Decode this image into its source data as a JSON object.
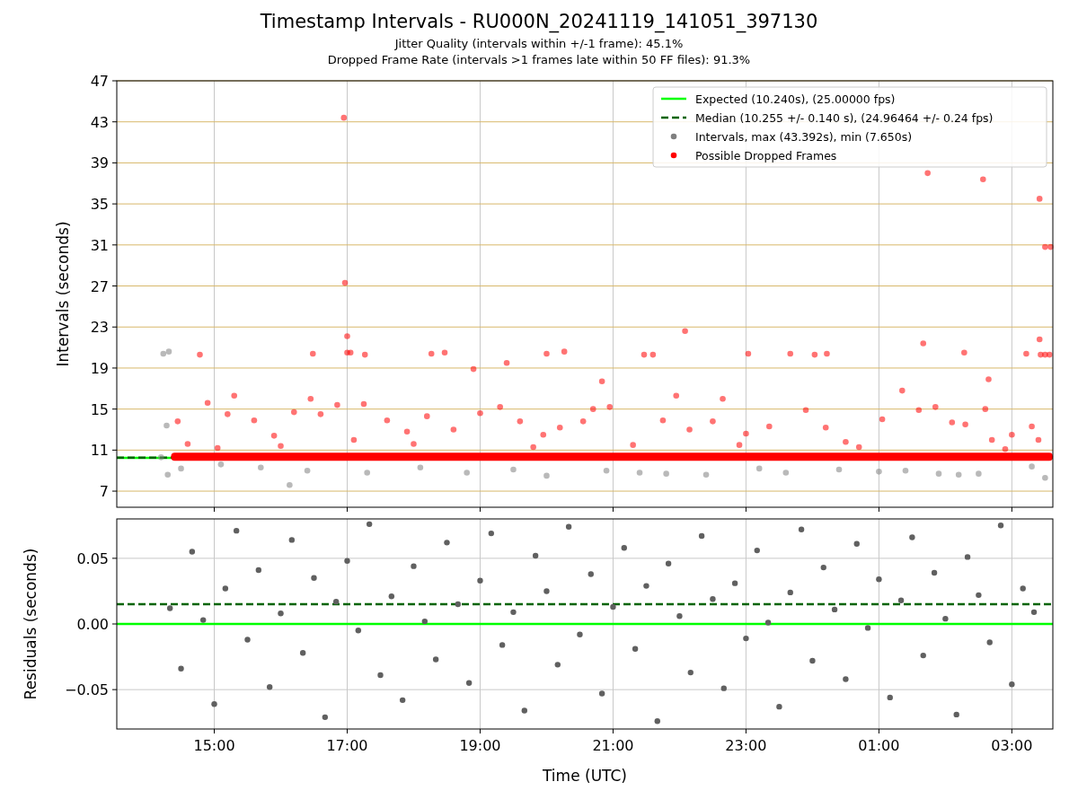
{
  "title": "Timestamp Intervals - RU000N_20241119_141051_397130",
  "subtitles": [
    "Jitter Quality (intervals within +/-1 frame): 45.1%",
    "Dropped Frame Rate (intervals >1 frames late within 50 FF files): 91.3%"
  ],
  "charts": [
    {
      "chart_data": {
        "type": "scatter",
        "ylabel": "Intervals (seconds)",
        "grid": true,
        "xlim": [
          "2024-11-19T13:32",
          "2024-11-20T03:37"
        ],
        "ylim": [
          5.43,
          47
        ],
        "yticks": [
          {
            "value": 7,
            "label": "7"
          },
          {
            "value": 11,
            "label": "11"
          },
          {
            "value": 15,
            "label": "15"
          },
          {
            "value": 19,
            "label": "19"
          },
          {
            "value": 23,
            "label": "23"
          },
          {
            "value": 27,
            "label": "27"
          },
          {
            "value": 31,
            "label": "31"
          },
          {
            "value": 35,
            "label": "35"
          },
          {
            "value": 39,
            "label": "39"
          },
          {
            "value": 43,
            "label": "43"
          },
          {
            "value": 47,
            "label": "47"
          }
        ],
        "legend": true,
        "ref_lines": [
          {
            "axis": "y",
            "value": 10.24,
            "label": "Expected (10.240s), (25.00000 fps)",
            "color": "#00ff00"
          },
          {
            "axis": "y",
            "value": 10.255,
            "label": "Median (10.255 +/- 0.140 s), (24.96464 +/- 0.24 fps)",
            "color": "#006400"
          }
        ],
        "bands": [
          {
            "axis": "y",
            "from": 9.95,
            "to": 10.75,
            "color": "#ff0000"
          }
        ],
        "series": [
          {
            "name": "Intervals, max (43.392s), min (7.650s)",
            "color": "#808080",
            "x": [
              "2024-11-19T14:14",
              "2024-11-19T14:19",
              "2024-11-19T14:17",
              "2024-11-19T14:18",
              "2024-11-19T16:08",
              "2024-11-19T14:30",
              "2024-11-19T15:06",
              "2024-11-19T15:42",
              "2024-11-19T16:24",
              "2024-11-19T17:18",
              "2024-11-19T18:06",
              "2024-11-19T18:48",
              "2024-11-19T19:30",
              "2024-11-19T20:00",
              "2024-11-19T20:54",
              "2024-11-19T21:24",
              "2024-11-19T21:48",
              "2024-11-19T22:24",
              "2024-11-19T23:12",
              "2024-11-19T23:36",
              "2024-11-20T00:24",
              "2024-11-20T01:00",
              "2024-11-20T01:24",
              "2024-11-20T01:54",
              "2024-11-20T02:12",
              "2024-11-20T02:30",
              "2024-11-20T03:30",
              "2024-11-20T03:18",
              "2024-11-19T14:12"
            ],
            "values": [
              20.4,
              20.6,
              13.4,
              8.6,
              7.6,
              9.2,
              9.6,
              9.3,
              9.0,
              8.8,
              9.3,
              8.8,
              9.1,
              8.5,
              9.0,
              8.8,
              8.7,
              8.6,
              9.2,
              8.8,
              9.1,
              8.9,
              9.0,
              8.7,
              8.6,
              8.7,
              8.3,
              9.4,
              10.3
            ]
          },
          {
            "name": "Possible Dropped Frames",
            "color": "#ff0000",
            "x": [
              "2024-11-19T16:57",
              "2024-11-19T16:58",
              "2024-11-19T17:00",
              "2024-11-19T17:00",
              "2024-11-19T17:03",
              "2024-11-19T14:47",
              "2024-11-19T16:29",
              "2024-11-19T17:16",
              "2024-11-19T18:16",
              "2024-11-19T18:28",
              "2024-11-19T18:54",
              "2024-11-19T19:24",
              "2024-11-19T20:00",
              "2024-11-19T20:16",
              "2024-11-19T20:50",
              "2024-11-19T21:28",
              "2024-11-19T21:36",
              "2024-11-19T22:05",
              "2024-11-19T23:02",
              "2024-11-19T23:40",
              "2024-11-20T00:02",
              "2024-11-20T00:13",
              "2024-11-20T01:44",
              "2024-11-20T01:40",
              "2024-11-20T02:34",
              "2024-11-20T02:17",
              "2024-11-20T02:39",
              "2024-11-20T03:25",
              "2024-11-20T03:30",
              "2024-11-20T03:35",
              "2024-11-20T03:13",
              "2024-11-20T03:25",
              "2024-11-20T03:26",
              "2024-11-20T03:30",
              "2024-11-20T03:34",
              "2024-11-19T14:27",
              "2024-11-19T14:54",
              "2024-11-19T15:12",
              "2024-11-19T15:18",
              "2024-11-19T15:36",
              "2024-11-19T15:54",
              "2024-11-19T16:12",
              "2024-11-19T16:27",
              "2024-11-19T16:36",
              "2024-11-19T16:51",
              "2024-11-19T17:06",
              "2024-11-19T17:15",
              "2024-11-19T17:36",
              "2024-11-19T17:54",
              "2024-11-19T18:12",
              "2024-11-19T18:36",
              "2024-11-19T19:00",
              "2024-11-19T19:18",
              "2024-11-19T19:36",
              "2024-11-19T19:57",
              "2024-11-19T20:12",
              "2024-11-19T20:33",
              "2024-11-19T20:42",
              "2024-11-19T20:57",
              "2024-11-19T21:18",
              "2024-11-19T21:45",
              "2024-11-19T21:57",
              "2024-11-19T22:09",
              "2024-11-19T22:30",
              "2024-11-19T22:39",
              "2024-11-19T23:00",
              "2024-11-19T23:21",
              "2024-11-19T23:54",
              "2024-11-20T00:12",
              "2024-11-20T00:30",
              "2024-11-20T01:03",
              "2024-11-20T01:21",
              "2024-11-20T01:36",
              "2024-11-20T01:51",
              "2024-11-20T02:06",
              "2024-11-20T02:18",
              "2024-11-20T02:36",
              "2024-11-20T02:42",
              "2024-11-20T03:00",
              "2024-11-20T03:18",
              "2024-11-20T03:24",
              "2024-11-19T14:36",
              "2024-11-19T15:03",
              "2024-11-19T16:00",
              "2024-11-19T18:00",
              "2024-11-19T19:48",
              "2024-11-19T22:54",
              "2024-11-20T00:42",
              "2024-11-20T02:54"
            ],
            "values": [
              43.4,
              27.3,
              22.1,
              20.5,
              20.5,
              20.3,
              20.4,
              20.3,
              20.4,
              20.5,
              18.9,
              19.5,
              20.4,
              20.6,
              17.7,
              20.3,
              20.3,
              22.6,
              20.4,
              20.4,
              20.3,
              20.4,
              38.0,
              21.4,
              37.4,
              20.5,
              17.9,
              35.5,
              30.8,
              30.8,
              20.4,
              21.8,
              20.3,
              20.3,
              20.3,
              13.8,
              15.6,
              14.5,
              16.3,
              13.9,
              12.4,
              14.7,
              16.0,
              14.5,
              15.4,
              12.0,
              15.5,
              13.9,
              12.8,
              14.3,
              13.0,
              14.6,
              15.2,
              13.8,
              12.5,
              13.2,
              13.8,
              15.0,
              15.2,
              11.5,
              13.9,
              16.3,
              13.0,
              13.8,
              16.0,
              12.6,
              13.3,
              14.9,
              13.2,
              11.8,
              14.0,
              16.8,
              14.9,
              15.2,
              13.7,
              13.5,
              15.0,
              12.0,
              12.5,
              13.3,
              12.0,
              11.6,
              11.2,
              11.4,
              11.6,
              11.3,
              11.5,
              11.3,
              11.1
            ]
          }
        ]
      }
    },
    {
      "chart_data": {
        "type": "scatter",
        "xlabel": "Time (UTC)",
        "ylabel": "Residuals (seconds)",
        "grid": true,
        "xlim": [
          "2024-11-19T13:32",
          "2024-11-20T03:37"
        ],
        "ylim": [
          -0.08,
          0.08
        ],
        "xticks": [
          {
            "value": "2024-11-19T15:00",
            "label": "15:00"
          },
          {
            "value": "2024-11-19T17:00",
            "label": "17:00"
          },
          {
            "value": "2024-11-19T19:00",
            "label": "19:00"
          },
          {
            "value": "2024-11-19T21:00",
            "label": "21:00"
          },
          {
            "value": "2024-11-19T23:00",
            "label": "23:00"
          },
          {
            "value": "2024-11-20T01:00",
            "label": "01:00"
          },
          {
            "value": "2024-11-20T03:00",
            "label": "03:00"
          }
        ],
        "yticks": [
          {
            "value": -0.05,
            "label": "−0.05"
          },
          {
            "value": 0,
            "label": "0.00"
          },
          {
            "value": 0.05,
            "label": "0.05"
          }
        ],
        "ref_lines": [
          {
            "axis": "y",
            "value": 0,
            "color": "#00ff00"
          },
          {
            "axis": "y",
            "value": 0.015,
            "color": "#006400"
          }
        ],
        "series": [
          {
            "color": "#606060",
            "x": [
              "2024-11-19T14:20",
              "2024-11-19T14:30",
              "2024-11-19T14:40",
              "2024-11-19T14:50",
              "2024-11-19T15:00",
              "2024-11-19T15:10",
              "2024-11-19T15:20",
              "2024-11-19T15:30",
              "2024-11-19T15:40",
              "2024-11-19T15:50",
              "2024-11-19T16:00",
              "2024-11-19T16:10",
              "2024-11-19T16:20",
              "2024-11-19T16:30",
              "2024-11-19T16:40",
              "2024-11-19T16:50",
              "2024-11-19T17:00",
              "2024-11-19T17:10",
              "2024-11-19T17:20",
              "2024-11-19T17:30",
              "2024-11-19T17:40",
              "2024-11-19T17:50",
              "2024-11-19T18:00",
              "2024-11-19T18:10",
              "2024-11-19T18:20",
              "2024-11-19T18:30",
              "2024-11-19T18:40",
              "2024-11-19T18:50",
              "2024-11-19T19:00",
              "2024-11-19T19:10",
              "2024-11-19T19:20",
              "2024-11-19T19:30",
              "2024-11-19T19:40",
              "2024-11-19T19:50",
              "2024-11-19T20:00",
              "2024-11-19T20:10",
              "2024-11-19T20:20",
              "2024-11-19T20:30",
              "2024-11-19T20:40",
              "2024-11-19T20:50",
              "2024-11-19T21:00",
              "2024-11-19T21:10",
              "2024-11-19T21:20",
              "2024-11-19T21:30",
              "2024-11-19T21:40",
              "2024-11-19T21:50",
              "2024-11-19T22:00",
              "2024-11-19T22:10",
              "2024-11-19T22:20",
              "2024-11-19T22:30",
              "2024-11-19T22:40",
              "2024-11-19T22:50",
              "2024-11-19T23:00",
              "2024-11-19T23:10",
              "2024-11-19T23:20",
              "2024-11-19T23:30",
              "2024-11-19T23:40",
              "2024-11-19T23:50",
              "2024-11-20T00:00",
              "2024-11-20T00:10",
              "2024-11-20T00:20",
              "2024-11-20T00:30",
              "2024-11-20T00:40",
              "2024-11-20T00:50",
              "2024-11-20T01:00",
              "2024-11-20T01:10",
              "2024-11-20T01:20",
              "2024-11-20T01:30",
              "2024-11-20T01:40",
              "2024-11-20T01:50",
              "2024-11-20T02:00",
              "2024-11-20T02:10",
              "2024-11-20T02:20",
              "2024-11-20T02:30",
              "2024-11-20T02:40",
              "2024-11-20T02:50",
              "2024-11-20T03:00",
              "2024-11-20T03:10",
              "2024-11-20T03:20"
            ],
            "values": [
              0.012,
              -0.034,
              0.055,
              0.003,
              -0.061,
              0.027,
              0.071,
              -0.012,
              0.041,
              -0.048,
              0.008,
              0.064,
              -0.022,
              0.035,
              -0.071,
              0.017,
              0.048,
              -0.005,
              0.076,
              -0.039,
              0.021,
              -0.058,
              0.044,
              0.002,
              -0.027,
              0.062,
              0.015,
              -0.045,
              0.033,
              0.069,
              -0.016,
              0.009,
              -0.066,
              0.052,
              0.025,
              -0.031,
              0.074,
              -0.008,
              0.038,
              -0.053,
              0.013,
              0.058,
              -0.019,
              0.029,
              -0.074,
              0.046,
              0.006,
              -0.037,
              0.067,
              0.019,
              -0.049,
              0.031,
              -0.011,
              0.056,
              0.001,
              -0.063,
              0.024,
              0.072,
              -0.028,
              0.043,
              0.011,
              -0.042,
              0.061,
              -0.003,
              0.034,
              -0.056,
              0.018,
              0.066,
              -0.024,
              0.039,
              0.004,
              -0.069,
              0.051,
              0.022,
              -0.014,
              0.075,
              -0.046,
              0.027,
              0.009
            ]
          }
        ]
      }
    }
  ]
}
